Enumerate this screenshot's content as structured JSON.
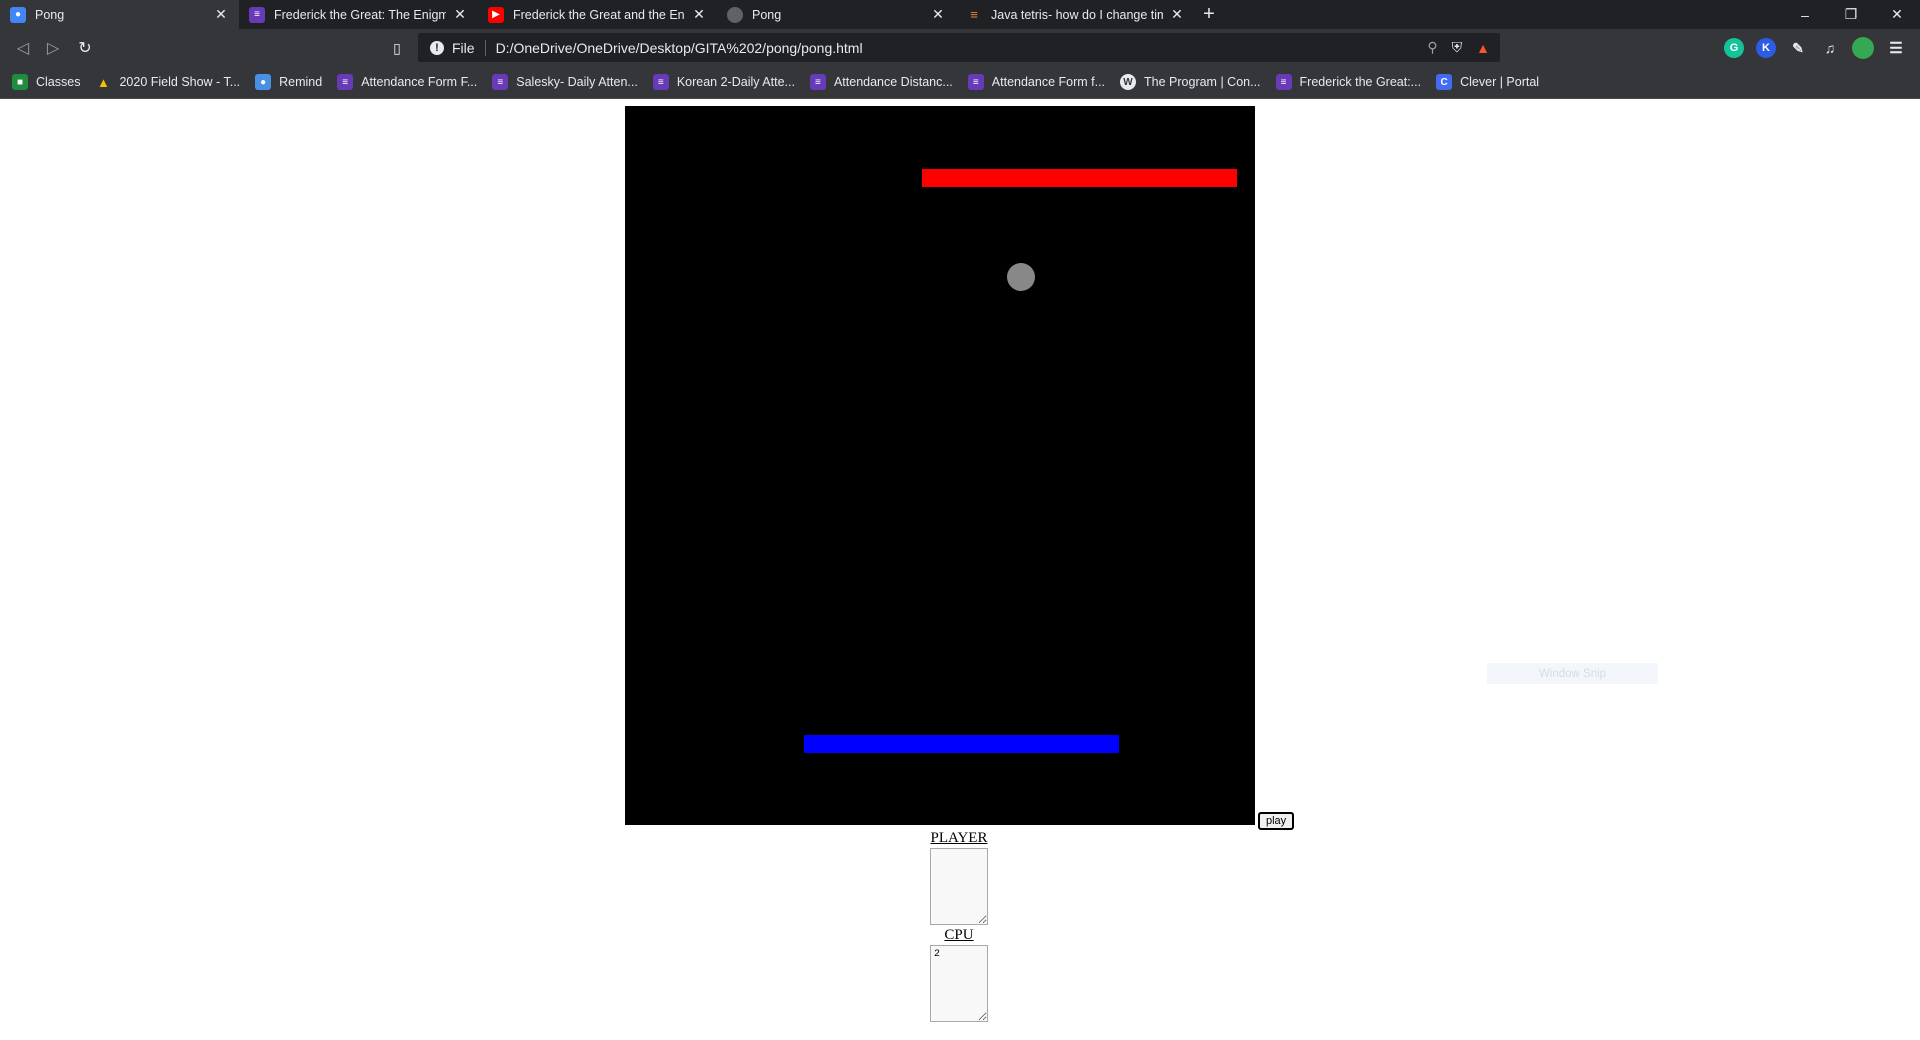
{
  "tabs": [
    {
      "title": "Pong",
      "favicon": "person-icon",
      "color": "#4285f4",
      "active": true
    },
    {
      "title": "Frederick the Great: The Enigma of",
      "favicon": "list-icon",
      "color": "#673ab7"
    },
    {
      "title": "Frederick the Great and the Enigm",
      "favicon": "youtube-icon",
      "color": "#ff0000"
    },
    {
      "title": "Pong",
      "favicon": "globe-icon",
      "color": "#5f6368"
    },
    {
      "title": "Java tetris- how do I change timer",
      "favicon": "stackoverflow-icon",
      "color": "#f48024"
    }
  ],
  "address": {
    "scheme_label": "File",
    "url": "D:/OneDrive/OneDrive/Desktop/GITA%202/pong/pong.html"
  },
  "bookmarks": [
    {
      "label": "Classes",
      "icon": "classroom-icon",
      "color": "#1e8e3e"
    },
    {
      "label": "2020 Field Show - T...",
      "icon": "drive-icon",
      "color": "#fbbc04"
    },
    {
      "label": "Remind",
      "icon": "remind-icon",
      "color": "#4a90e2"
    },
    {
      "label": "Attendance Form F...",
      "icon": "form-icon",
      "color": "#673ab7"
    },
    {
      "label": "Salesky- Daily Atten...",
      "icon": "form-icon",
      "color": "#673ab7"
    },
    {
      "label": "Korean 2-Daily Atte...",
      "icon": "form-icon",
      "color": "#673ab7"
    },
    {
      "label": "Attendance Distanc...",
      "icon": "form-icon",
      "color": "#673ab7"
    },
    {
      "label": "Attendance Form f...",
      "icon": "form-icon",
      "color": "#673ab7"
    },
    {
      "label": "The Program | Con...",
      "icon": "wordpress-icon",
      "color": "#e8eaed"
    },
    {
      "label": "Frederick the Great:...",
      "icon": "form-icon",
      "color": "#673ab7"
    },
    {
      "label": "Clever | Portal",
      "icon": "clever-icon",
      "color": "#436cf2"
    }
  ],
  "game": {
    "cpu_paddle_color": "#ff0000",
    "player_paddle_color": "#0000ff",
    "ball_color": "#888888",
    "background": "#000000"
  },
  "controls": {
    "play_label": "play",
    "player_label": "PLAYER",
    "player_score": "",
    "cpu_label": "CPU",
    "cpu_score": "2"
  },
  "overlay": {
    "snip_label": "Window Snip"
  }
}
